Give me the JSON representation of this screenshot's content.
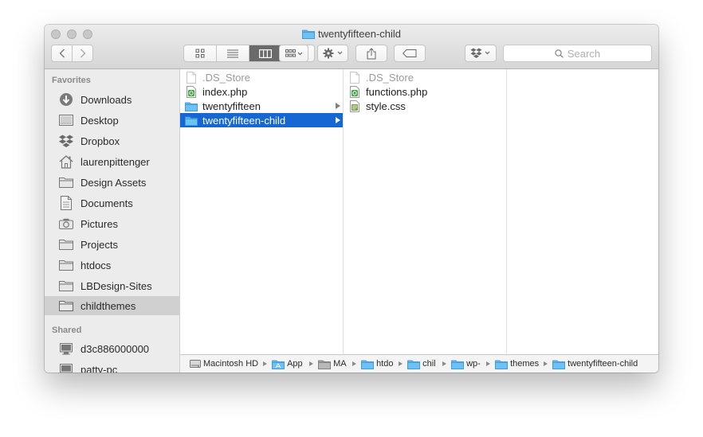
{
  "window": {
    "title": "twentyfifteen-child"
  },
  "toolbar": {
    "search_placeholder": "Search",
    "views": [
      "icon-view",
      "list-view",
      "column-view",
      "cover-flow-view"
    ]
  },
  "sidebar": {
    "favorites_header": "Favorites",
    "favorites": [
      {
        "label": "Downloads",
        "icon": "downloads-icon"
      },
      {
        "label": "Desktop",
        "icon": "desktop-icon"
      },
      {
        "label": "Dropbox",
        "icon": "dropbox-icon"
      },
      {
        "label": "laurenpittenger",
        "icon": "home-icon"
      },
      {
        "label": "Design Assets",
        "icon": "folder-icon"
      },
      {
        "label": "Documents",
        "icon": "documents-icon"
      },
      {
        "label": "Pictures",
        "icon": "camera-icon"
      },
      {
        "label": "Projects",
        "icon": "folder-icon"
      },
      {
        "label": "htdocs",
        "icon": "folder-icon"
      },
      {
        "label": "LBDesign-Sites",
        "icon": "folder-icon"
      },
      {
        "label": "childthemes",
        "icon": "folder-icon",
        "selected": true
      }
    ],
    "shared_header": "Shared",
    "shared": [
      {
        "label": "d3c886000000",
        "icon": "computer-icon"
      },
      {
        "label": "patty-pc",
        "icon": "computer-icon"
      }
    ]
  },
  "columns": [
    {
      "items": [
        {
          "name": ".DS_Store",
          "kind": "file",
          "dim": true
        },
        {
          "name": "index.php",
          "kind": "php"
        },
        {
          "name": "twentyfifteen",
          "kind": "folder",
          "arrow": true
        },
        {
          "name": "twentyfifteen-child",
          "kind": "folder",
          "arrow": true,
          "selected": true
        }
      ]
    },
    {
      "items": [
        {
          "name": ".DS_Store",
          "kind": "file",
          "dim": true
        },
        {
          "name": "functions.php",
          "kind": "php"
        },
        {
          "name": "style.css",
          "kind": "css"
        }
      ]
    },
    {
      "items": []
    }
  ],
  "pathbar": [
    {
      "label": "Macintosh HD",
      "icon": "disk-icon"
    },
    {
      "label": "App",
      "icon": "apps-folder-icon"
    },
    {
      "label": "MA",
      "icon": "folder-gray-icon"
    },
    {
      "label": "htdo",
      "icon": "folder-icon"
    },
    {
      "label": "chil",
      "icon": "folder-icon"
    },
    {
      "label": "wp-",
      "icon": "folder-icon"
    },
    {
      "label": "themes",
      "icon": "folder-icon"
    },
    {
      "label": "twentyfifteen-child",
      "icon": "folder-icon"
    }
  ],
  "colors": {
    "selection": "#1567d3",
    "folder": "#5fb6ef"
  }
}
